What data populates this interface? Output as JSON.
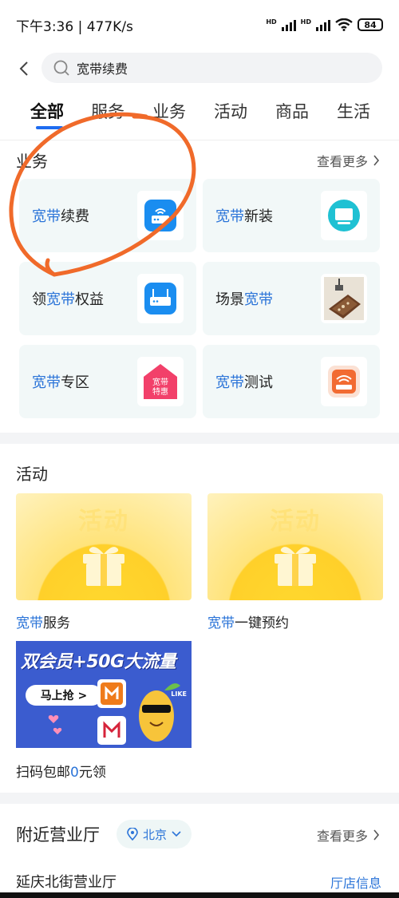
{
  "status": {
    "time": "下午3:36",
    "speed": "477K/s",
    "network1": "HD",
    "network2": "HD",
    "battery": "84"
  },
  "search": {
    "query": "宽带续费"
  },
  "tabs": [
    "全部",
    "服务",
    "业务",
    "活动",
    "商品",
    "生活"
  ],
  "business": {
    "title": "业务",
    "more": "查看更多",
    "items": [
      {
        "prefix": "",
        "hl": "宽带",
        "suffix": "续费",
        "icon": "router-icon"
      },
      {
        "prefix": "",
        "hl": "宽带",
        "suffix": "新装",
        "icon": "monitor-icon"
      },
      {
        "prefix": "领",
        "hl": "宽带",
        "suffix": "权益",
        "icon": "router-icon"
      },
      {
        "prefix": "场景",
        "hl": "宽带",
        "suffix": "",
        "icon": "scene-photo-icon"
      },
      {
        "prefix": "",
        "hl": "宽带",
        "suffix": "专区",
        "icon": "house-badge-icon",
        "badge_line1": "宽带",
        "badge_line2": "特惠"
      },
      {
        "prefix": "",
        "hl": "宽带",
        "suffix": "测试",
        "icon": "wifi-router-icon"
      }
    ]
  },
  "activities": {
    "title": "活动",
    "promo_text": "活动",
    "items": [
      {
        "prefix": "",
        "hl": "宽带",
        "suffix": "服务"
      },
      {
        "prefix": "",
        "hl": "宽带",
        "suffix": "一键预约"
      },
      {
        "prefix": "扫码包邮",
        "hl": "0",
        "suffix": "元领"
      }
    ],
    "banner": {
      "title": "双会员+50G大流量",
      "button": "马上抢 >",
      "logo_text": "LIKE"
    }
  },
  "nearby": {
    "title": "附近营业厅",
    "city": "北京",
    "more": "查看更多",
    "store_name": "延庆北街营业厅",
    "store_info": "厅店信息"
  },
  "colors": {
    "accent": "#1e6cf0",
    "highlight": "#2b74d8",
    "card_bg": "#f2f8f8",
    "annotation": "#f06a2a"
  }
}
